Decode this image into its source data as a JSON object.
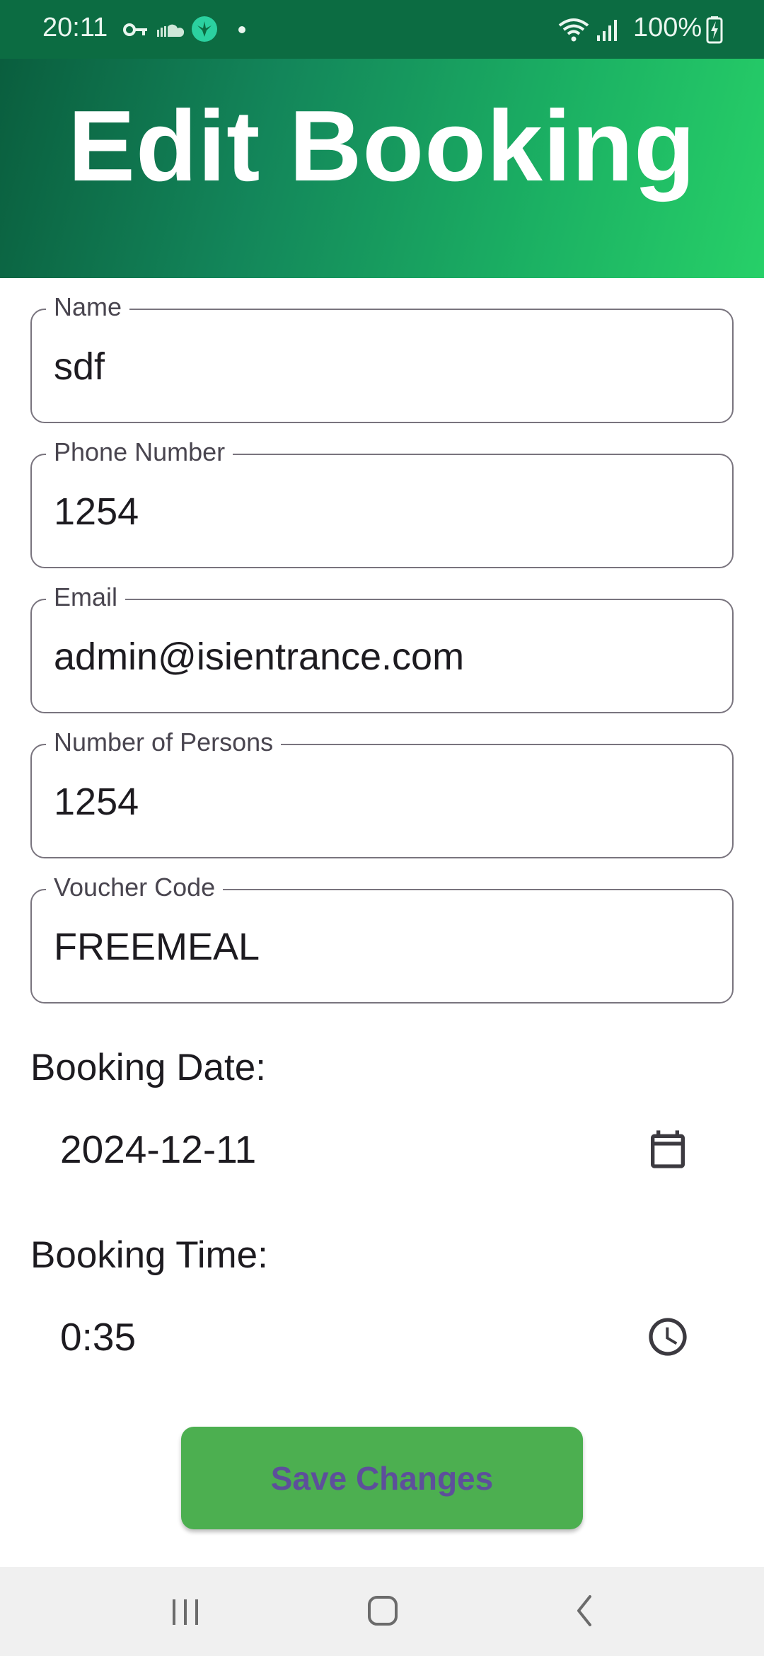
{
  "status_bar": {
    "time": "20:11",
    "battery_text": "100%",
    "icons": [
      "key-icon",
      "cloud-icon",
      "app-notification-icon",
      "dot-icon",
      "wifi-icon",
      "signal-icon",
      "battery-charging-icon"
    ]
  },
  "header": {
    "title": "Edit Booking"
  },
  "form": {
    "name": {
      "label": "Name",
      "value": "sdf"
    },
    "phone": {
      "label": "Phone Number",
      "value": "1254"
    },
    "email": {
      "label": "Email",
      "value": "admin@isientrance.com"
    },
    "persons": {
      "label": "Number of Persons",
      "value": "1254"
    },
    "voucher": {
      "label": "Voucher Code",
      "value": "FREEMEAL"
    }
  },
  "booking_date": {
    "label": "Booking Date:",
    "value": "2024-12-11",
    "icon": "calendar-icon"
  },
  "booking_time": {
    "label": "Booking Time:",
    "value": "0:35",
    "icon": "clock-icon"
  },
  "save_button": {
    "label": "Save Changes"
  },
  "colors": {
    "header_start": "#0a5e3e",
    "header_end": "#27d068",
    "button_bg": "#4caf50",
    "button_text": "#5d4f9b"
  }
}
